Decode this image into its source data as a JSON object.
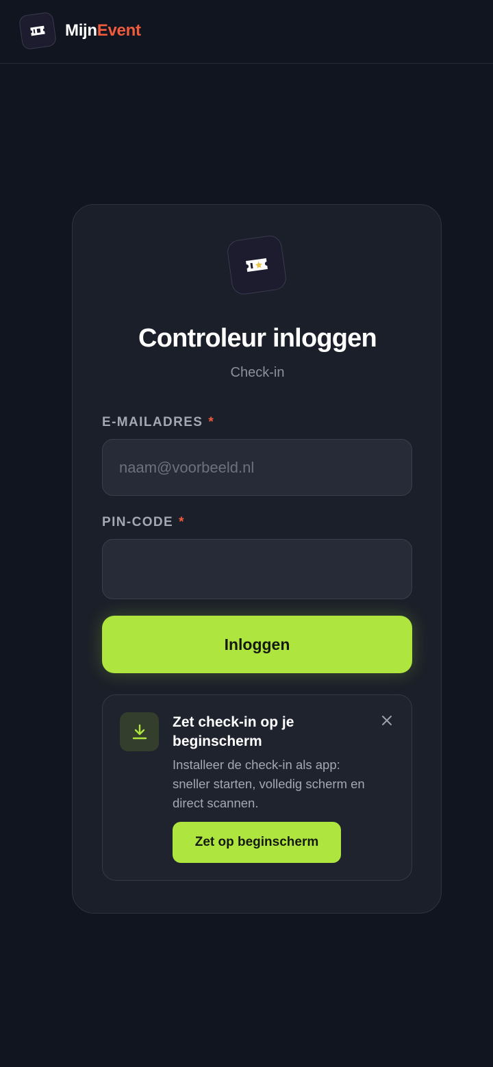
{
  "app": {
    "name_part1": "Mijn",
    "name_part2": "Event",
    "logo_icon": "ticket-icon",
    "accent_color": "#aee63f",
    "brand_color": "#ef5b3c"
  },
  "login": {
    "title": "Controleur inloggen",
    "subtitle": "Check-in",
    "email": {
      "label": "E-MAILADRES",
      "required_marker": "*",
      "placeholder": "naam@voorbeeld.nl",
      "value": ""
    },
    "pin": {
      "label": "PIN-CODE",
      "required_marker": "*",
      "value": ""
    },
    "submit_label": "Inloggen"
  },
  "install_prompt": {
    "icon": "download-icon",
    "title": "Zet check-in op je beginscherm",
    "description": "Installeer de check-in als app: sneller starten, volledig scherm en direct scannen.",
    "button_label": "Zet op beginscherm",
    "close_icon": "close-icon"
  }
}
